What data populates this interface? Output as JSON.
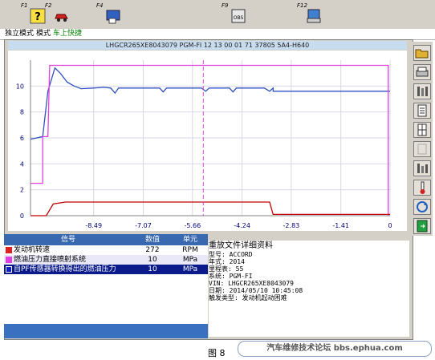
{
  "toolbar": {
    "keys": [
      {
        "label": "F1",
        "icon": "help-question-icon"
      },
      {
        "label": "F2",
        "icon": "car-icon"
      },
      {
        "label": "F4",
        "icon": "data-record-icon"
      },
      {
        "label": "F9",
        "icon": "obd-icon"
      },
      {
        "label": "F12",
        "icon": "print-screen-icon"
      }
    ],
    "obd_text": "OBS"
  },
  "modebar": {
    "mode1": "独立模式",
    "mode2": "模式",
    "mode3": "车上快捷"
  },
  "vin_header": "LHGCR265XE8043079  PGM-FI  12 13 00 01 71  37805 5A4-H640",
  "chart_data": {
    "type": "line",
    "x_tick_labels": [
      "-8.49",
      "-7.07",
      "-5.66",
      "-4.24",
      "-2.83",
      "-1.41",
      "0"
    ],
    "y_tick_labels": [
      "0",
      "2",
      "4",
      "6",
      "8",
      "10"
    ],
    "ylim": [
      0,
      12
    ],
    "xlim": [
      -10.3,
      0
    ],
    "cursor_x": -5.35,
    "series": [
      {
        "color": "#3050c0",
        "points": [
          [
            -10.3,
            5.9
          ],
          [
            -9.95,
            6.1
          ],
          [
            -9.8,
            9.6
          ],
          [
            -9.6,
            11.4
          ],
          [
            -9.45,
            11.0
          ],
          [
            -9.25,
            10.3
          ],
          [
            -9.05,
            10.0
          ],
          [
            -8.85,
            9.8
          ],
          [
            -8.5,
            9.85
          ],
          [
            -8.2,
            9.9
          ],
          [
            -8.0,
            9.85
          ],
          [
            -7.88,
            9.45
          ],
          [
            -7.78,
            9.85
          ],
          [
            -7.0,
            9.85
          ],
          [
            -6.6,
            9.85
          ],
          [
            -6.5,
            9.55
          ],
          [
            -6.4,
            9.85
          ],
          [
            -5.4,
            9.85
          ],
          [
            -5.28,
            9.6
          ],
          [
            -5.18,
            9.85
          ],
          [
            -4.6,
            9.85
          ],
          [
            -4.5,
            9.55
          ],
          [
            -4.4,
            9.85
          ],
          [
            -3.6,
            9.85
          ],
          [
            -3.45,
            9.6
          ],
          [
            -3.35,
            9.85
          ],
          [
            -3.35,
            9.6
          ],
          [
            0,
            9.6
          ]
        ]
      },
      {
        "color": "#e040e0",
        "points": [
          [
            -10.3,
            2.5
          ],
          [
            -9.95,
            2.5
          ],
          [
            -9.95,
            6.1
          ],
          [
            -9.8,
            6.1
          ],
          [
            -9.75,
            11.6
          ],
          [
            -0.05,
            11.6
          ],
          [
            -0.05,
            0
          ]
        ]
      },
      {
        "color": "#c00000",
        "points": [
          [
            -10.3,
            0
          ],
          [
            -9.85,
            0
          ],
          [
            -9.65,
            0.9
          ],
          [
            -9.3,
            1.05
          ],
          [
            -3.45,
            1.05
          ],
          [
            -3.35,
            0.1
          ],
          [
            0,
            0.1
          ]
        ]
      }
    ]
  },
  "grid": {
    "headers": {
      "signal": "信号",
      "value": "数值",
      "unit": "单元"
    },
    "rows": [
      {
        "name": "发动机转速",
        "value": "272",
        "unit": "RPM",
        "color": "#e02020"
      },
      {
        "name": "燃油压力直接喷射系统",
        "value": "10",
        "unit": "MPa",
        "color": "#e040e0"
      },
      {
        "name": "自PF传感器转换得出的燃油压力",
        "value": "10",
        "unit": "MPa",
        "color": "#1020c0"
      }
    ]
  },
  "detail": {
    "title": "重放文件详细资料",
    "lines": [
      "型号: ACCORD",
      "年式: 2014",
      "里程表:  55",
      "系统: PGM-FI",
      "VIN: LHGCR265XE8043079",
      "日期: 2014/05/10 10:45:08",
      "触发类型: 发动机起动困难"
    ]
  },
  "caption": "图 8",
  "watermark": "汽车维修技术论坛 bbs.ephua.com"
}
